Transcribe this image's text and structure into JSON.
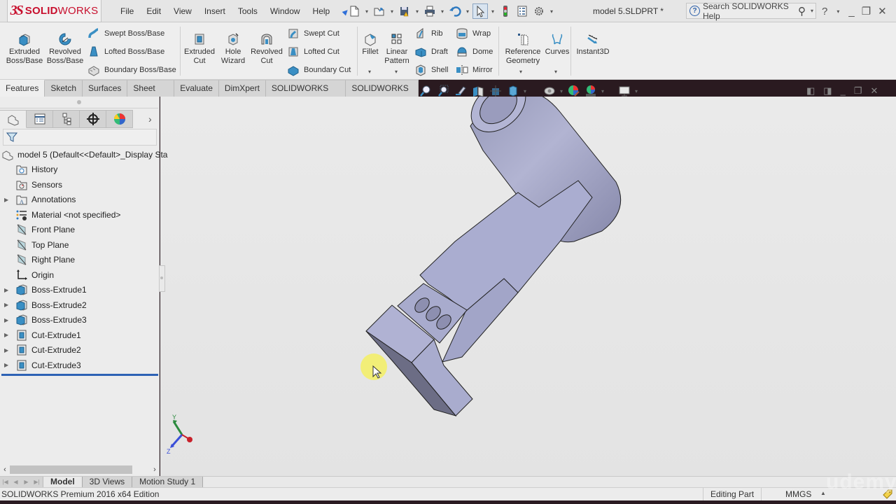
{
  "app": {
    "logo_prefix": "3S",
    "logo_bold": "SOLID",
    "logo_light": "WORKS",
    "document_title": "model 5.SLDPRT *"
  },
  "menu": [
    "File",
    "Edit",
    "View",
    "Insert",
    "Tools",
    "Window",
    "Help"
  ],
  "quick_access": [
    {
      "name": "new-document",
      "icon": "new-document-icon"
    },
    {
      "name": "open",
      "icon": "open-folder-icon"
    },
    {
      "name": "save",
      "icon": "save-icon"
    },
    {
      "name": "print",
      "icon": "print-icon"
    },
    {
      "name": "undo",
      "icon": "undo-icon"
    },
    {
      "name": "select",
      "icon": "select-arrow-icon"
    },
    {
      "name": "rebuild",
      "icon": "traffic-light-icon"
    },
    {
      "name": "file-properties",
      "icon": "properties-icon"
    },
    {
      "name": "options",
      "icon": "gear-icon"
    }
  ],
  "help_search": {
    "placeholder": "Search SOLIDWORKS Help"
  },
  "window_controls": {
    "help": "?",
    "minimize": "_",
    "restore": "❐",
    "close": "✕"
  },
  "command_manager": {
    "extruded_boss": "Extruded\nBoss/Base",
    "extruded_boss_l1": "Extruded",
    "extruded_boss_l2": "Boss/Base",
    "revolved_boss_l1": "Revolved",
    "revolved_boss_l2": "Boss/Base",
    "swept_boss": "Swept Boss/Base",
    "lofted_boss": "Lofted Boss/Base",
    "boundary_boss": "Boundary Boss/Base",
    "extruded_cut_l1": "Extruded",
    "extruded_cut_l2": "Cut",
    "hole_wizard_l1": "Hole",
    "hole_wizard_l2": "Wizard",
    "revolved_cut_l1": "Revolved",
    "revolved_cut_l2": "Cut",
    "swept_cut": "Swept Cut",
    "lofted_cut": "Lofted Cut",
    "boundary_cut": "Boundary Cut",
    "fillet": "Fillet",
    "linear_pattern_l1": "Linear",
    "linear_pattern_l2": "Pattern",
    "rib": "Rib",
    "draft": "Draft",
    "shell": "Shell",
    "wrap": "Wrap",
    "dome": "Dome",
    "mirror": "Mirror",
    "reference_geometry_l1": "Reference",
    "reference_geometry_l2": "Geometry",
    "curves": "Curves",
    "instant3d": "Instant3D"
  },
  "tabs": [
    "Features",
    "Sketch",
    "Surfaces",
    "Sheet Metal",
    "Evaluate",
    "DimXpert",
    "SOLIDWORKS Add-Ins",
    "SOLIDWORKS MBD"
  ],
  "active_tab": "Features",
  "heads_up_toolbar": [
    "zoom-to-fit-icon",
    "zoom-to-area-icon",
    "previous-view-icon",
    "section-view-icon",
    "view-orientation-icon",
    "display-style-icon",
    "hide-show-items-icon",
    "edit-appearance-icon",
    "apply-scene-icon",
    "view-settings-icon"
  ],
  "feature_manager": {
    "panel_tabs": [
      "featuremanager-tree-icon",
      "propertymanager-icon",
      "configurationmanager-icon",
      "dimxpertmanager-icon",
      "displaymanager-icon"
    ],
    "root": "model 5  (Default<<Default>_Display Sta",
    "items": [
      {
        "label": "History",
        "icon": "history-folder-icon",
        "expandable": false
      },
      {
        "label": "Sensors",
        "icon": "sensors-folder-icon",
        "expandable": false
      },
      {
        "label": "Annotations",
        "icon": "annotations-folder-icon",
        "expandable": true
      },
      {
        "label": "Material <not specified>",
        "icon": "material-icon",
        "expandable": false
      },
      {
        "label": "Front Plane",
        "icon": "plane-icon",
        "expandable": false
      },
      {
        "label": "Top Plane",
        "icon": "plane-icon",
        "expandable": false
      },
      {
        "label": "Right Plane",
        "icon": "plane-icon",
        "expandable": false
      },
      {
        "label": "Origin",
        "icon": "origin-icon",
        "expandable": false
      },
      {
        "label": "Boss-Extrude1",
        "icon": "boss-extrude-icon",
        "expandable": true
      },
      {
        "label": "Boss-Extrude2",
        "icon": "boss-extrude-icon",
        "expandable": true
      },
      {
        "label": "Boss-Extrude3",
        "icon": "boss-extrude-icon",
        "expandable": true
      },
      {
        "label": "Cut-Extrude1",
        "icon": "cut-extrude-icon",
        "expandable": true
      },
      {
        "label": "Cut-Extrude2",
        "icon": "cut-extrude-icon",
        "expandable": true
      },
      {
        "label": "Cut-Extrude3",
        "icon": "cut-extrude-icon",
        "expandable": true
      }
    ]
  },
  "triad": {
    "y": "Y",
    "z": "Z"
  },
  "bottom_tabs": [
    "Model",
    "3D Views",
    "Motion Study 1"
  ],
  "active_bottom_tab": "Model",
  "status": {
    "edition": "SOLIDWORKS Premium 2016 x64 Edition",
    "mode": "Editing Part",
    "units": "MMGS"
  },
  "watermark": "udemy",
  "colors": {
    "brand_red": "#c8102e",
    "part_face": "#a9accb",
    "rollback_bar": "#2d62b5"
  }
}
